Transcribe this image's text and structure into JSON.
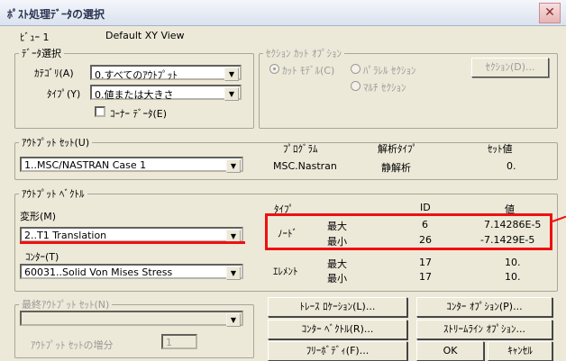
{
  "window": {
    "title": "ﾎﾟｽﾄ処理ﾃﾞｰﾀの選択"
  },
  "view": {
    "label": "ﾋﾞｭｰ 1",
    "value": "Default XY View"
  },
  "data_selection": {
    "legend": "ﾃﾞｰﾀ選択",
    "category_label": "ｶﾃｺﾞﾘ(A)",
    "category_value": "0.すべてのｱｳﾄﾌﾟｯﾄ",
    "type_label": "ﾀｲﾌﾟ(Y)",
    "type_value": "0.値または大きさ",
    "corner_data_label": "ｺｰﾅｰ ﾃﾞｰﾀ(E)"
  },
  "section_cut": {
    "legend": "ｾｸｼｮﾝ ｶｯﾄ ｵﾌﾟｼｮﾝ",
    "cut_model": "ｶｯﾄ ﾓﾃﾞﾙ(C)",
    "parallel": "ﾊﾟﾗﾚﾙ ｾｸｼｮﾝ",
    "multi": "ﾏﾙﾁ ｾｸｼｮﾝ",
    "section_button": "ｾｸｼｮﾝ(D)..."
  },
  "output_set": {
    "legend": "ｱｳﾄﾌﾟｯﾄ ｾｯﾄ(U)",
    "value": "1..MSC/NASTRAN Case 1",
    "col_program": "ﾌﾟﾛｸﾞﾗﾑ",
    "col_analysis": "解析ﾀｲﾌﾟ",
    "col_setvalue": "ｾｯﾄ値",
    "program": "MSC.Nastran",
    "analysis": "静解析",
    "set_value": "0."
  },
  "output_vector": {
    "legend": "ｱｳﾄﾌﾟｯﾄ ﾍﾞｸﾄﾙ",
    "deform_label": "変形(M)",
    "deform_value": "2..T1 Translation",
    "contour_label": "ｺﾝﾀｰ(T)",
    "contour_value": "60031..Solid Von Mises Stress",
    "col_type": "ﾀｲﾌﾟ",
    "col_id": "ID",
    "col_value": "値",
    "rows": [
      {
        "type": "ﾉｰﾄﾞ",
        "kind": "最大",
        "id": "6",
        "value": "7.14286E-5"
      },
      {
        "type": "",
        "kind": "最小",
        "id": "26",
        "value": "-7.1429E-5"
      },
      {
        "type": "ｴﾚﾒﾝﾄ",
        "kind": "最大",
        "id": "17",
        "value": "10."
      },
      {
        "type": "",
        "kind": "最小",
        "id": "17",
        "value": "10."
      }
    ]
  },
  "final_output": {
    "legend": "最終ｱｳﾄﾌﾟｯﾄ ｾｯﾄ(N)",
    "increment_label": "ｱｳﾄﾌﾟｯﾄ ｾｯﾄの増分",
    "increment_value": "1"
  },
  "buttons": {
    "trace": "ﾄﾚｰｽ ﾛｹｰｼｮﾝ(L)...",
    "contour_options": "ｺﾝﾀｰ ｵﾌﾟｼｮﾝ(P)...",
    "contour_vector": "ｺﾝﾀｰ ﾍﾞｸﾄﾙ(R)...",
    "streamline": "ｽﾄﾘｰﾑﾗｲﾝ ｵﾌﾟｼｮﾝ...",
    "freebody": "ﾌﾘｰﾎﾞﾃﾞｨ(F)...",
    "ok": "OK",
    "cancel": "ｷｬﾝｾﾙ"
  },
  "colors": {
    "highlight": "#ee1111",
    "dialog_bg": "#ece9d8"
  }
}
